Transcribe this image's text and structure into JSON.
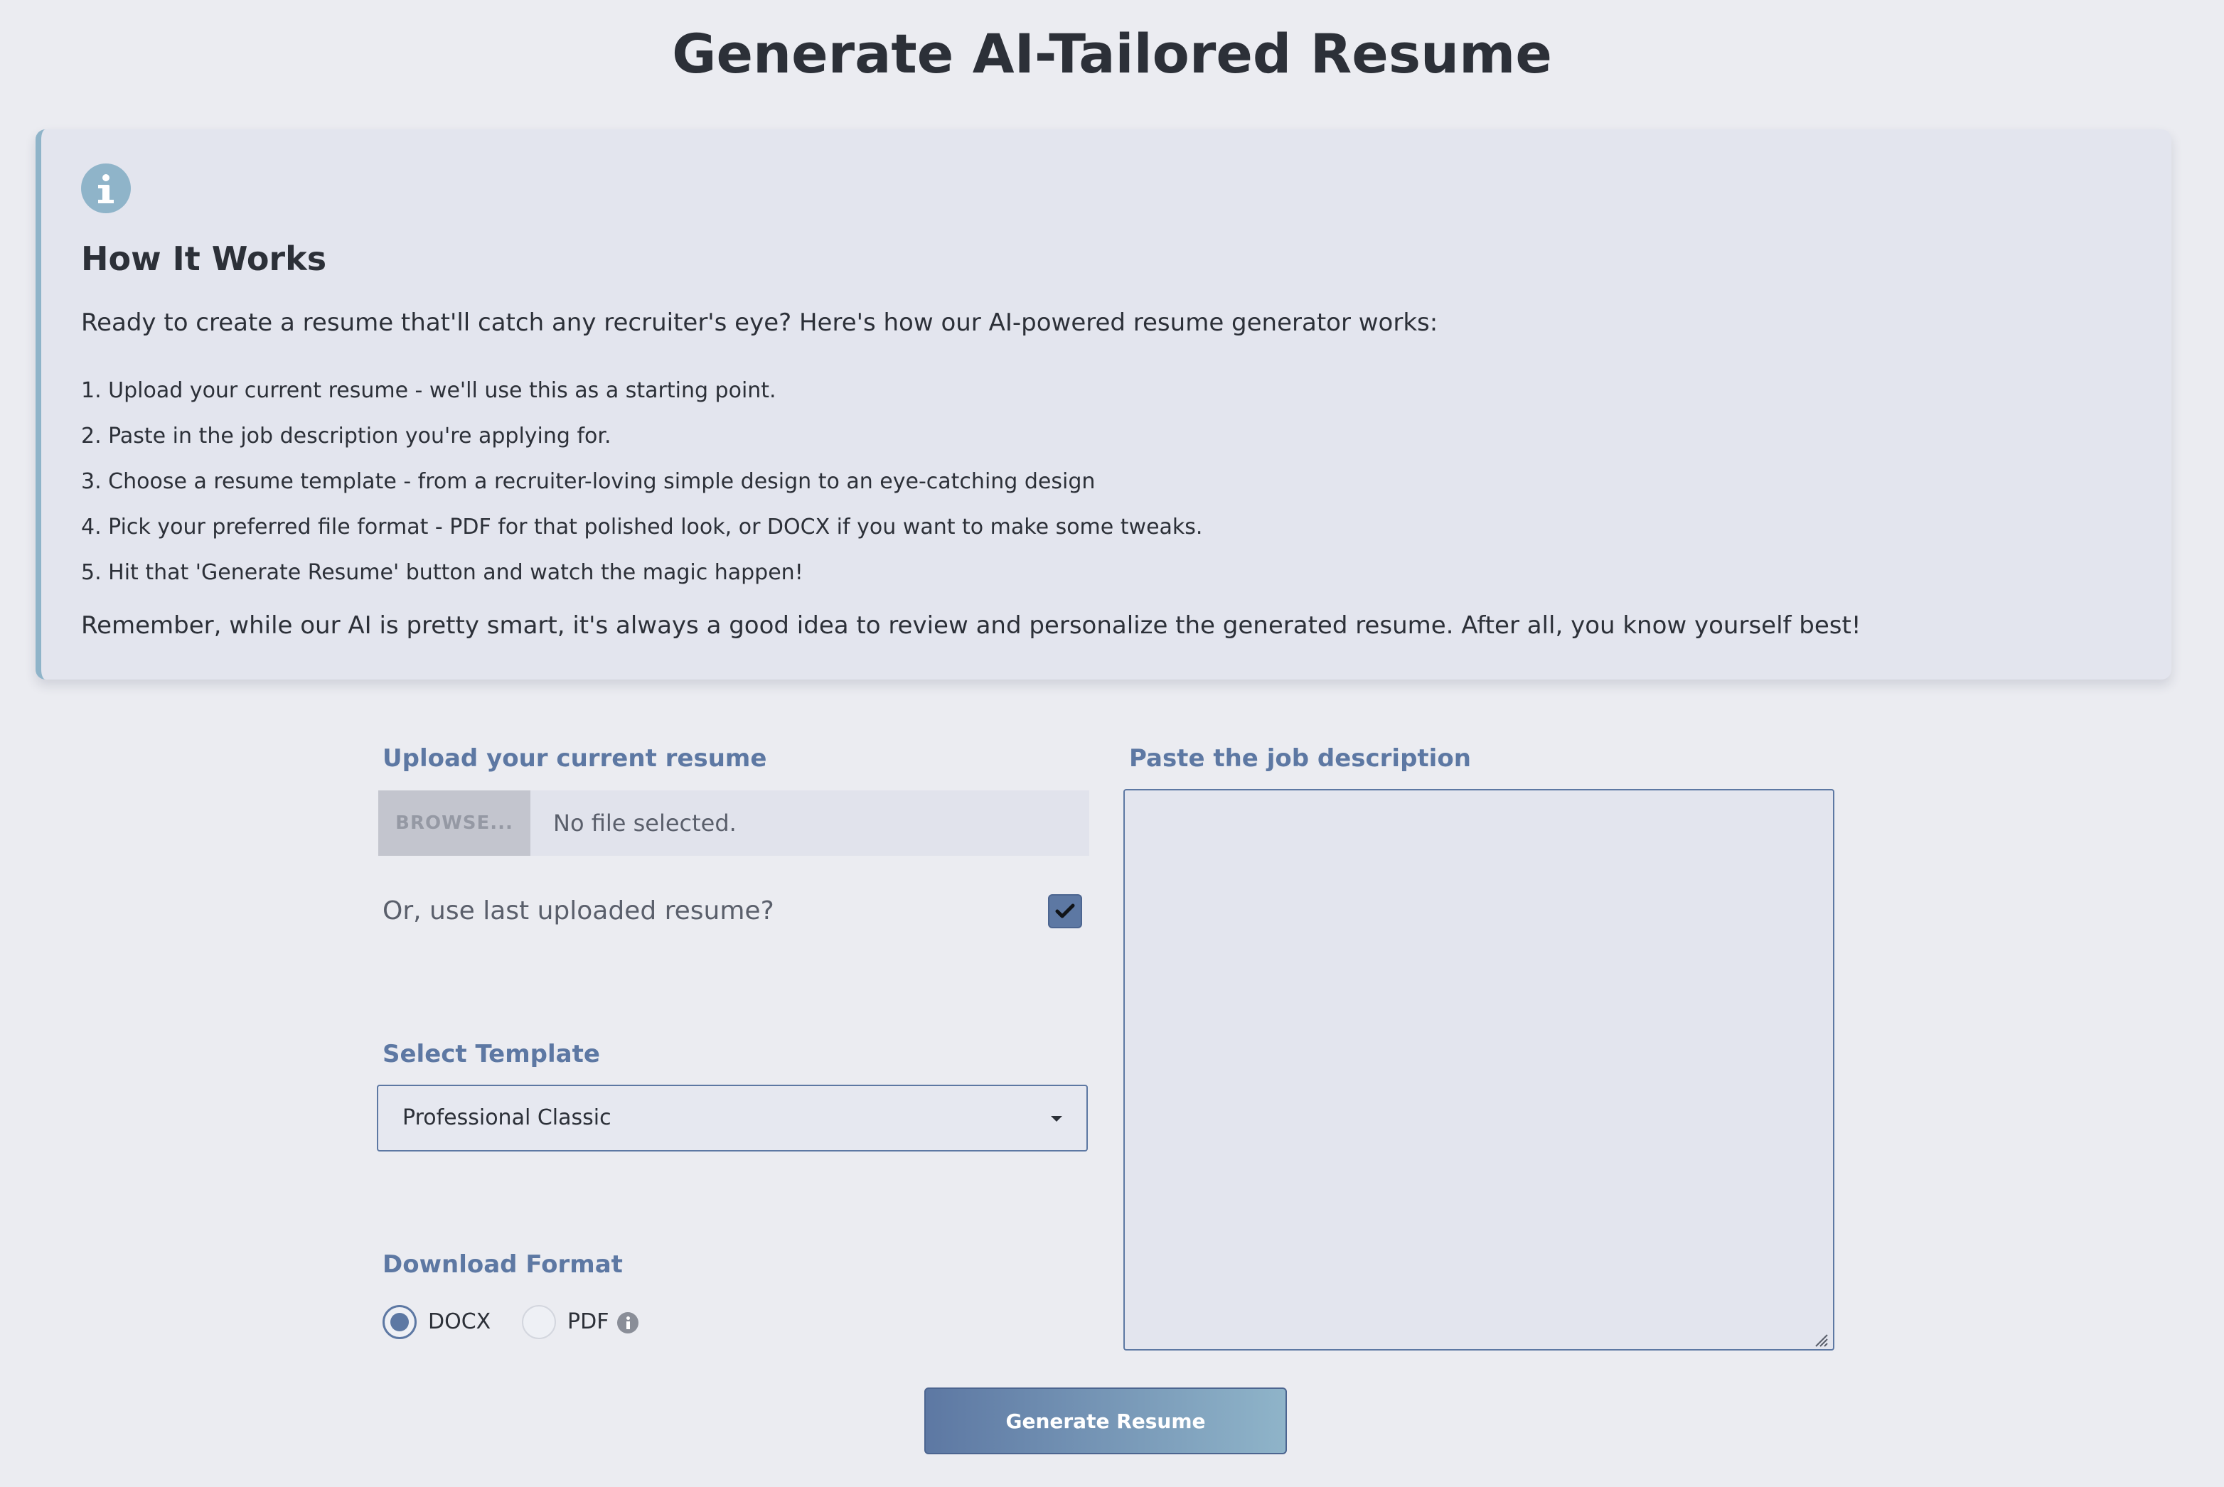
{
  "page": {
    "title": "Generate AI-Tailored Resume"
  },
  "info": {
    "icon": "info-icon",
    "heading": "How It Works",
    "intro": "Ready to create a resume that'll catch any recruiter's eye? Here's how our AI-powered resume generator works:",
    "steps": [
      "1. Upload your current resume - we'll use this as a starting point.",
      "2. Paste in the job description you're applying for.",
      "3. Choose a resume template - from a recruiter-loving simple design to an eye-catching design",
      "4. Pick your preferred file format - PDF for that polished look, or DOCX if you want to make some tweaks.",
      "5. Hit that 'Generate Resume' button and watch the magic happen!"
    ],
    "remember": "Remember, while our AI is pretty smart, it's always a good idea to review and personalize the generated resume. After all, you know yourself best!"
  },
  "upload": {
    "label": "Upload your current resume",
    "browse_label": "BROWSE...",
    "file_status": "No file selected.",
    "reuse_label": "Or, use last uploaded resume?",
    "reuse_checked": true
  },
  "template": {
    "label": "Select Template",
    "selected": "Professional Classic"
  },
  "format": {
    "label": "Download Format",
    "options": [
      "DOCX",
      "PDF"
    ],
    "selected": "DOCX"
  },
  "job": {
    "label": "Paste the job description",
    "value": ""
  },
  "actions": {
    "generate_label": "Generate Resume"
  },
  "colors": {
    "background": "#ebecf1",
    "accent": "#5d78a3",
    "info_accent": "#8fb4c9",
    "text": "#2c3038"
  }
}
